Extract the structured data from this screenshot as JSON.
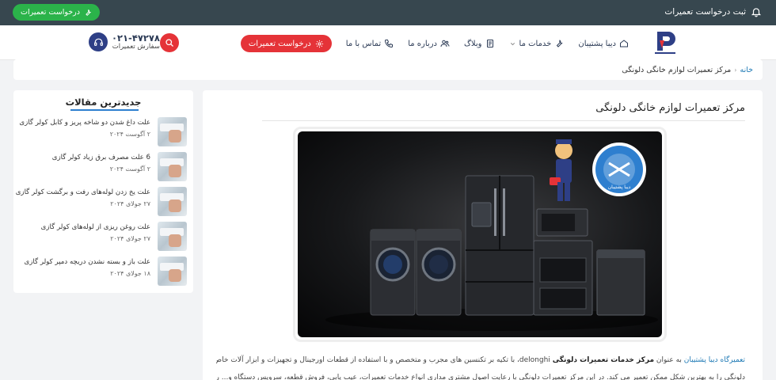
{
  "topbar": {
    "register_label": "ثبت درخواست تعمیرات",
    "request_button": "درخواست تعمیرات"
  },
  "header": {
    "nav": [
      {
        "label": "دیبا پشتیبان",
        "icon": "home-icon"
      },
      {
        "label": "خدمات ما",
        "icon": "wrench-icon"
      },
      {
        "label": "وبلاگ",
        "icon": "document-icon"
      },
      {
        "label": "درباره ما",
        "icon": "users-icon"
      },
      {
        "label": "تماس با ما",
        "icon": "phone-icon"
      }
    ],
    "request_button": "درخواست تعمیرات",
    "phone_number": "۰۲۱-۴۷۲۷۸",
    "phone_caption": "سفارش تعمیرات"
  },
  "breadcrumb": {
    "home": "خانه",
    "separator": "‹",
    "current": "مرکز تعمیرات لوازم خانگی دلونگی"
  },
  "article": {
    "title": "مرکز تعمیرات لوازم خانگی دلونگی",
    "hero_badge_text": "دیبا پشتیبان",
    "para1_link": "تعمیرگاه دیبا پشتیبان",
    "para1_a": " به عنوان ",
    "para1_bold": "مرکز خدمات تعمیرات دلونگی",
    "para1_b": " delonghi، با تکیه بر تکنسین های مجرب و متخصص و با استفاده از قطعات اورجینال و تجهیزات و ابزار آلات خاص، انواع دستگاه ها و لوازم خانگی",
    "para2": "دلونگی را به بهترین شکل ممکن تعمیر می کند. در این مرکز تعمیرات دلونگی با رعایت اصول مشتری مداری انواع خدمات تعمیرات، عیب یابی، فروش قطعه، سرویس دستگاه و... را می توانید با بالاترین کیفیت"
  },
  "sidebar": {
    "title": "جدیدترین مقالات",
    "posts": [
      {
        "title": "علت داغ شدن دو شاخه پریز و کابل کولر گازی",
        "date": "۲ آگوست ۲۰۲۴"
      },
      {
        "title": "6 علت مصرف برق زیاد کولر گازی",
        "date": "۲ آگوست ۲۰۲۴"
      },
      {
        "title": "علت یخ زدن لوله‌های رفت و برگشت کولر گازی",
        "date": "۲۷ جولای ۲۰۲۴"
      },
      {
        "title": "علت روغن ریزی از لوله‌های کولر گازی",
        "date": "۲۷ جولای ۲۰۲۴"
      },
      {
        "title": "علت باز و بسته نشدن دریچه دمپر کولر گازی",
        "date": "۱۸ جولای ۲۰۲۴"
      }
    ]
  },
  "colors": {
    "topbar_bg": "#37474f",
    "green_button": "#2bb34a",
    "accent_red": "#e53338",
    "brand_navy": "#2e3f86",
    "link_blue": "#1f7ab5"
  }
}
